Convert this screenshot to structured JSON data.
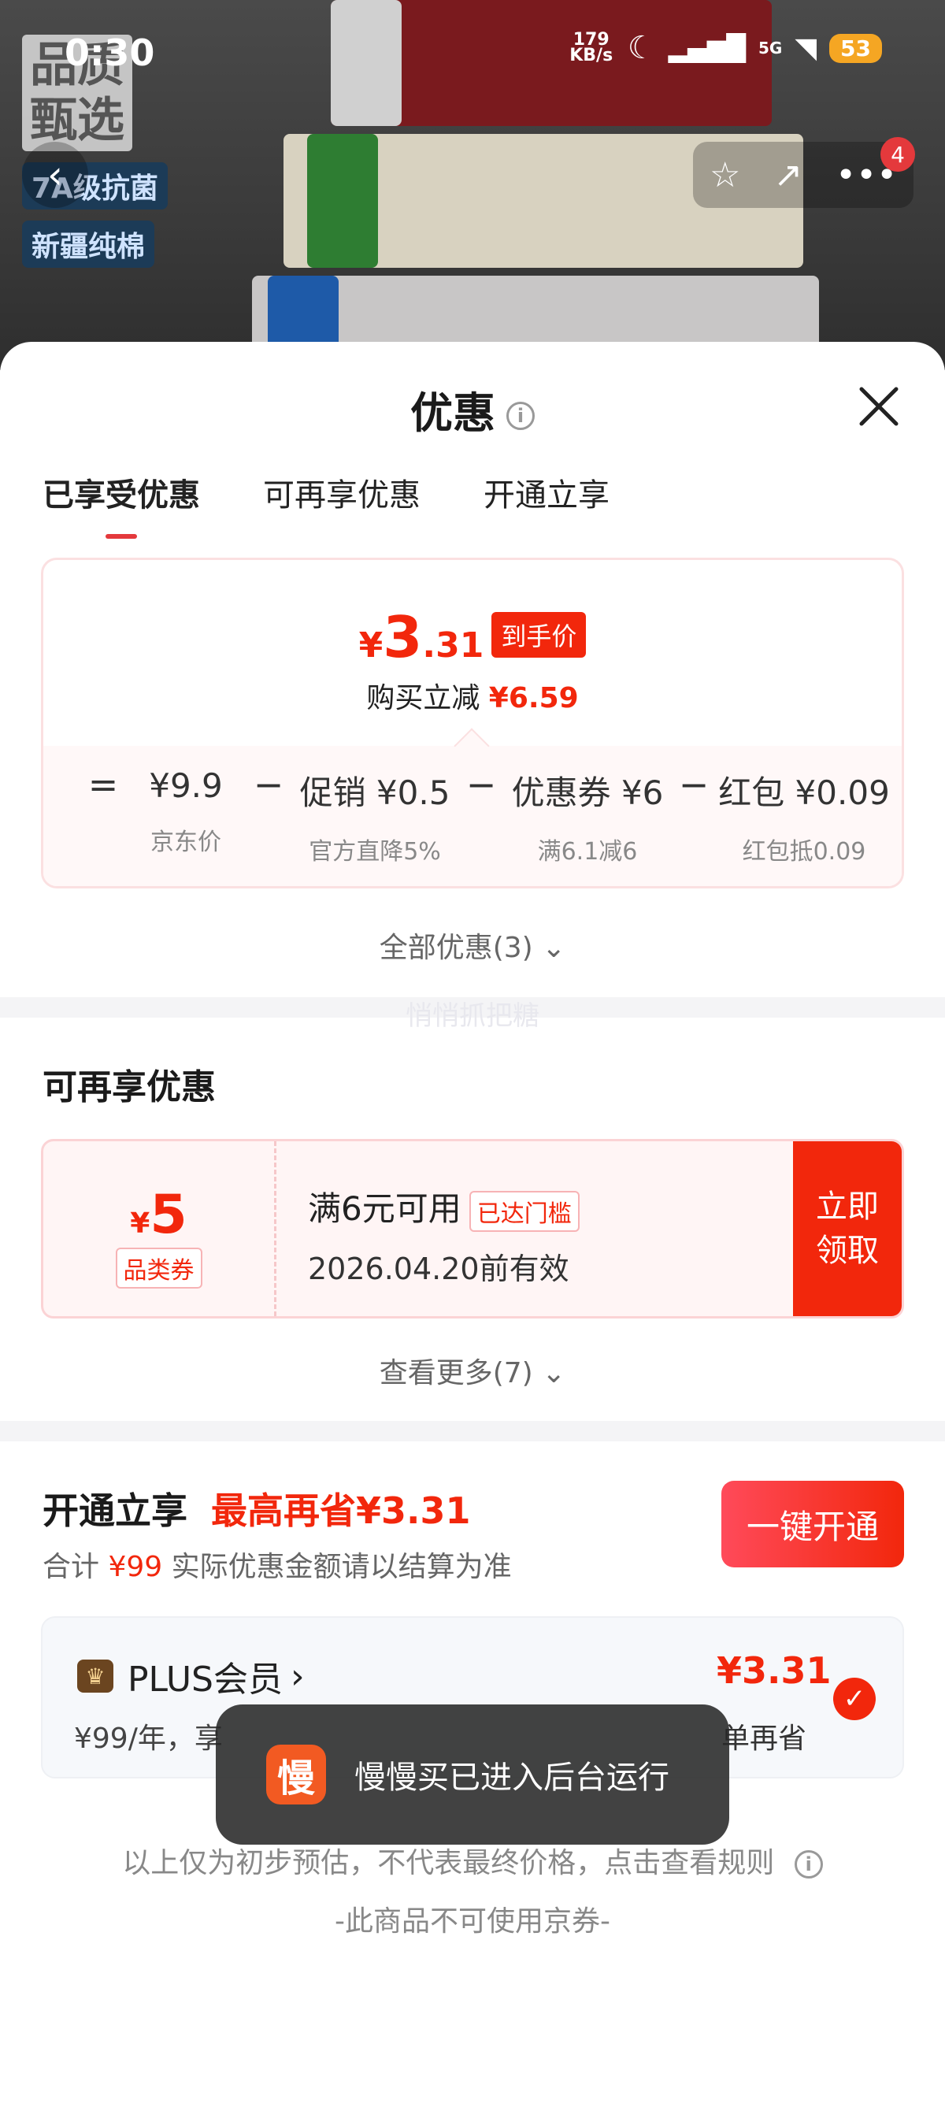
{
  "status_bar": {
    "time": "0:30",
    "net_speed": "179 KB/s",
    "signal": "5G",
    "battery": "53"
  },
  "product_bg": {
    "brand_tag": "品质\n甄选",
    "tags": [
      "7A级抗菌",
      "新疆纯棉"
    ],
    "nav_badge": "4"
  },
  "sheet": {
    "title": "优惠",
    "tabs": [
      "已享受优惠",
      "可再享优惠",
      "开通立享"
    ],
    "enjoyed": {
      "price_symbol": "¥",
      "price_int": "3",
      "price_dec": ".31",
      "price_tag": "到手价",
      "reduce_label": "购买立减",
      "reduce_value": "¥6.59",
      "formula": [
        {
          "op": "=",
          "value": "¥9.9",
          "label": "京东价"
        },
        {
          "op": "−",
          "value": "促销 ¥0.5",
          "label": "官方直降5%"
        },
        {
          "op": "−",
          "value": "优惠券 ¥6",
          "label": "满6.1减6"
        },
        {
          "op": "−",
          "value": "红包 ¥0.09",
          "label": "红包抵0.09"
        }
      ],
      "all_promos": "全部优惠(3)"
    },
    "watermark": "悄悄抓把糖",
    "more_promos": {
      "title": "可再享优惠",
      "coupon": {
        "symbol": "¥",
        "value": "5",
        "type": "品类券",
        "condition": "满6元可用",
        "status": "已达门槛",
        "validity": "2026.04.20前有效",
        "button": "立即\n领取"
      },
      "view_more": "查看更多(7)"
    },
    "membership": {
      "title": "开通立享",
      "max_save": "最高再省¥3.31",
      "total_prefix": "合计",
      "total_value": "¥99",
      "total_suffix": "实际优惠金额请以结算为准",
      "open_button": "一键开通",
      "plus": {
        "name": "PLUS会员",
        "price_desc": "¥99/年，享",
        "save_value": "¥3.31",
        "save_label": "单再省"
      }
    },
    "toast": {
      "icon": "慢",
      "text": "慢慢买已进入后台运行"
    },
    "footer": {
      "disclaimer": "以上仅为初步预估，不代表最终价格，点击查看规则",
      "note": "-此商品不可使用京券-"
    }
  },
  "colors": {
    "accent": "#f2270c",
    "card_border": "#fbe0e1"
  }
}
